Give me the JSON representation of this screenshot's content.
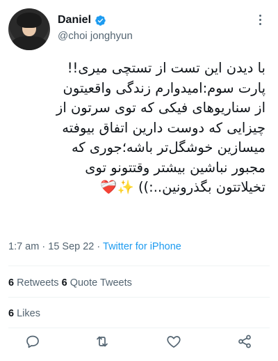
{
  "tweet": {
    "display_name": "Daniel",
    "handle": "@choi jonghyun",
    "text": "با دیدن این تست از تستچی میری!!\nپارت سوم:امیدوارم زندگی واقعیتون\nاز سناریوهای فیکی که توی سرتون از\nچیزایی که دوست دارین اتفاق بیوفته\nمیسازین خوشگل‌تر باشه؛جوری که\nمجبور نباشین بیشتر وقتتونو توی\nتخیلاتتون بگذرونین..:)) ✨❤️‍🩹",
    "time": "1:7 am",
    "date": "15 Sep 22",
    "separator": "·",
    "source": "Twitter for iPhone"
  },
  "stats": {
    "retweets_count": "6",
    "retweets_label": "Retweets",
    "quotes_count": "6",
    "quotes_label": "Quote Tweets",
    "likes_count": "6",
    "likes_label": "Likes"
  },
  "icons": {
    "verified": "verified-badge-icon",
    "more": "more-dots-icon",
    "reply": "reply-icon",
    "retweet": "retweet-icon",
    "like": "heart-icon",
    "share": "share-icon"
  },
  "colors": {
    "accent": "#1d9bf0",
    "secondary_text": "#536471",
    "primary_text": "#0f1419"
  }
}
